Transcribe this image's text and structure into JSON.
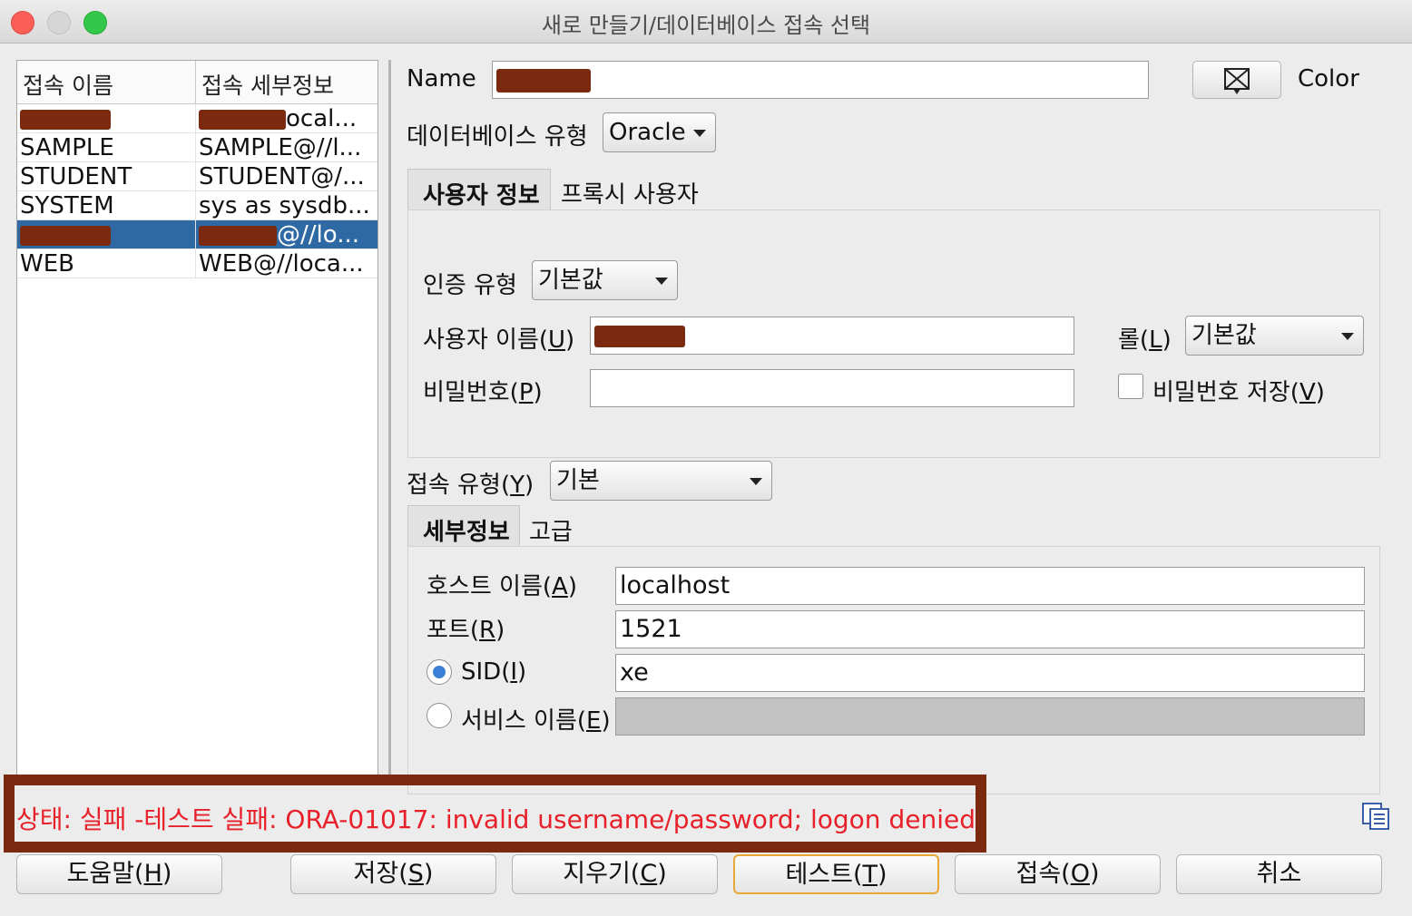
{
  "window": {
    "title": "새로 만들기/데이터베이스 접속 선택"
  },
  "connections": {
    "headers": {
      "name": "접속 이름",
      "detail": "접속 세부정보"
    },
    "rows": [
      {
        "name": "",
        "detail": "ocal...",
        "redacted": true,
        "selected": false
      },
      {
        "name": "SAMPLE",
        "detail": "SAMPLE@//l...",
        "redacted": false,
        "selected": false
      },
      {
        "name": "STUDENT",
        "detail": "STUDENT@/...",
        "redacted": false,
        "selected": false
      },
      {
        "name": "SYSTEM",
        "detail": "sys as sysdb...",
        "redacted": false,
        "selected": false
      },
      {
        "name": "",
        "detail": "@//lo...",
        "redacted": true,
        "selected": true
      },
      {
        "name": "WEB",
        "detail": "WEB@//loca...",
        "redacted": false,
        "selected": false
      }
    ]
  },
  "form": {
    "name_label": "Name",
    "color_label": "Color",
    "db_type_label": "데이터베이스 유형",
    "db_type_value": "Oracle",
    "tabs_user": [
      "사용자 정보",
      "프록시 사용자"
    ],
    "auth_type_label": "인증 유형",
    "auth_type_value": "기본값",
    "username_label": "사용자 이름(",
    "username_key": "U",
    "role_label": "롤(",
    "role_key": "L",
    "role_value": "기본값",
    "password_label": "비밀번호(",
    "password_key": "P",
    "save_password_label": "비밀번호 저장(",
    "save_password_key": "V",
    "conn_type_label": "접속 유형(",
    "conn_type_key": "Y",
    "conn_type_value": "기본",
    "tabs_conn": [
      "세부정보",
      "고급"
    ],
    "host_label": "호스트 이름(",
    "host_key": "A",
    "host_value": "localhost",
    "port_label": "포트(",
    "port_key": "R",
    "port_value": "1521",
    "sid_label": "SID(",
    "sid_key": "I",
    "sid_value": "xe",
    "service_label": "서비스 이름(",
    "service_key": "E",
    "close_paren": ")"
  },
  "status": {
    "text": "상태: 실패 -테스트 실패: ORA-01017: invalid username/password; logon denied",
    "color": "#e8202a"
  },
  "buttons": {
    "help": {
      "label": "도움말(",
      "key": "H"
    },
    "save": {
      "label": "저장(",
      "key": "S"
    },
    "clear": {
      "label": "지우기(",
      "key": "C"
    },
    "test": {
      "label": "테스트(",
      "key": "T"
    },
    "connect": {
      "label": "접속(",
      "key": "O"
    },
    "cancel": {
      "label": "취소"
    }
  },
  "colors": {
    "selection": "#2f69a4",
    "redaction": "#7b2a10",
    "focus": "#e7a838"
  }
}
